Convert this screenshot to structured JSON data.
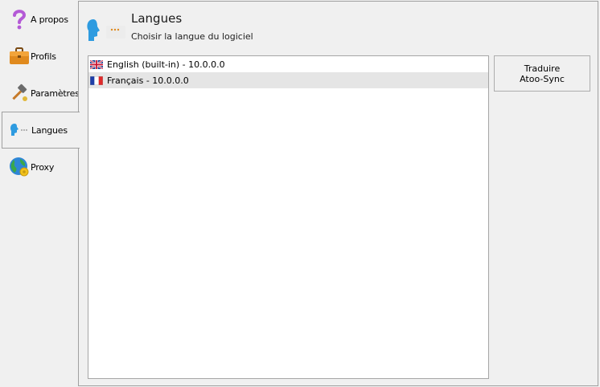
{
  "tabs": [
    {
      "label": "A propos",
      "icon": "question-icon"
    },
    {
      "label": "Profils",
      "icon": "briefcase-icon"
    },
    {
      "label": "Paramètres",
      "icon": "hammer-icon"
    },
    {
      "label": "Langues",
      "icon": "speaking-head-icon",
      "active": true
    },
    {
      "label": "Proxy",
      "icon": "globe-icon"
    }
  ],
  "header": {
    "title": "Langues",
    "subtitle": "Choisir la langue du logiciel"
  },
  "languages": [
    {
      "label": "English (built-in) - 10.0.0.0",
      "flag": "uk-flag-icon",
      "selected": false
    },
    {
      "label": "Français - 10.0.0.0",
      "flag": "france-flag-icon",
      "selected": true
    }
  ],
  "translate_button": {
    "line1": "Traduire",
    "line2": "Atoo-Sync"
  },
  "colors": {
    "accent_blue": "#2e9be0",
    "question_purple": "#b45ad6",
    "briefcase_orange": "#e08a1e",
    "selection_gray": "#e5e5e5"
  }
}
